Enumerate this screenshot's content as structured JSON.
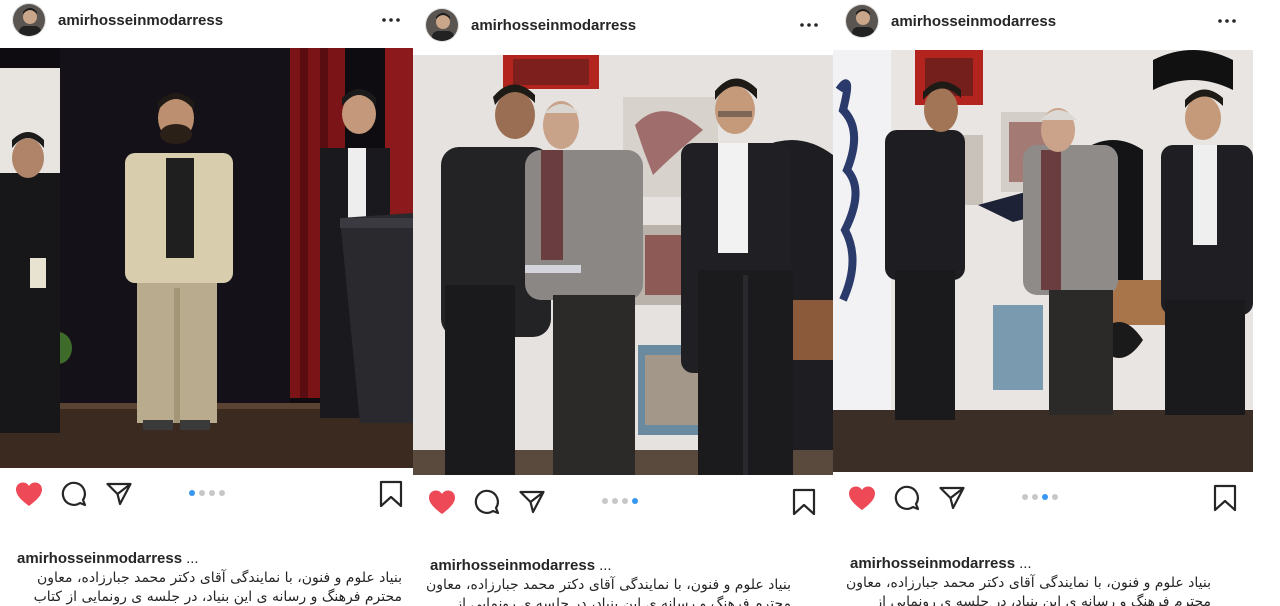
{
  "posts": [
    {
      "username": "amirhosseinmodarress",
      "caption_username": "amirhosseinmodarress",
      "caption_more": "...",
      "caption_lines": [
        "بنیاد علوم و فنون، با نمایندگی آقای دکتر محمد جبارزاده، معاون",
        "محترم فرهنگ و رسانه ی این بنیاد، در جلسه ی رونمایی از کتاب جام"
      ],
      "liked": true,
      "carousel": {
        "count": 4,
        "active": 1
      }
    },
    {
      "username": "amirhosseinmodarress",
      "caption_username": "amirhosseinmodarress",
      "caption_more": "...",
      "caption_lines": [
        "بنیاد علوم و فنون، با نمایندگی آقای دکتر محمد جبارزاده، معاون",
        "محترم فرهنگ و رسانه ی این بنیاد، در جلسه ی رونمایی از کتاب جام"
      ],
      "liked": true,
      "carousel": {
        "count": 4,
        "active": 4
      }
    },
    {
      "username": "amirhosseinmodarress",
      "caption_username": "amirhosseinmodarress",
      "caption_more": "...",
      "caption_lines": [
        "بنیاد علوم و فنون، با نمایندگی آقای دکتر محمد جبارزاده، معاون",
        "محترم فرهنگ و رسانه ی این بنیاد، در جلسه ی رونمایی از کتاب جام"
      ],
      "liked": true,
      "carousel": {
        "count": 4,
        "active": 3
      }
    }
  ],
  "colors": {
    "like": "#ed4956",
    "icon": "#262626",
    "dot_active": "#3897f0",
    "dot_inactive": "#c7c7c7"
  }
}
